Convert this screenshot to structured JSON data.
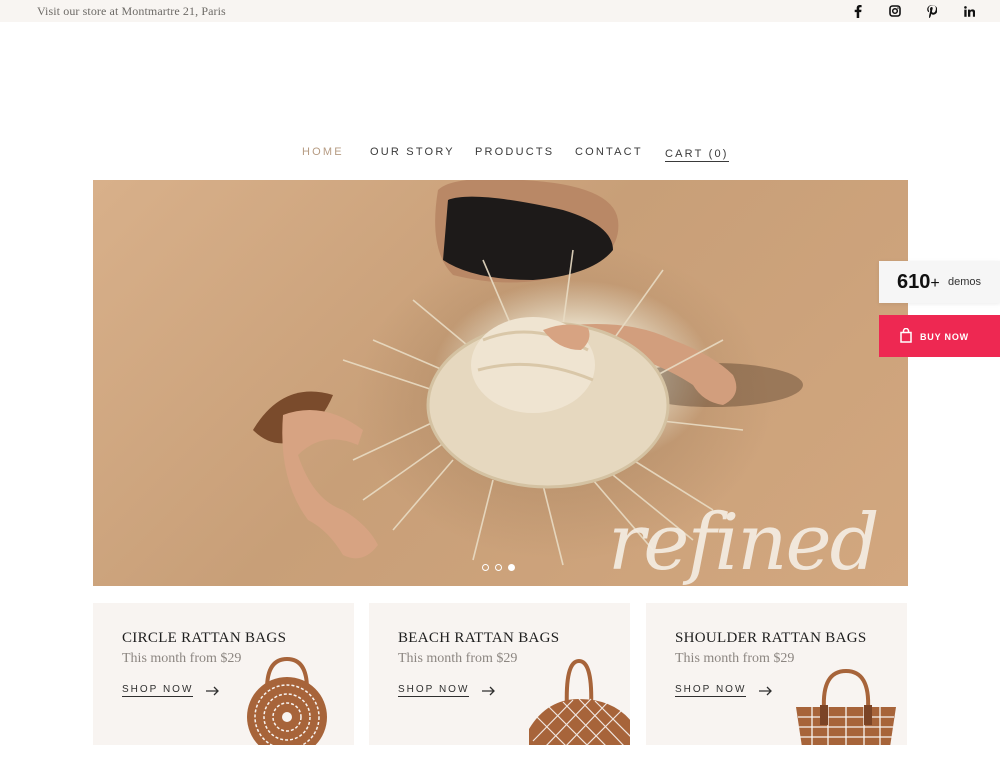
{
  "topbar": {
    "address": "Visit our store at Montmartre 21, Paris",
    "social": [
      "facebook-icon",
      "instagram-icon",
      "pinterest-icon",
      "linkedin-icon"
    ]
  },
  "nav": {
    "home": "HOME",
    "story": "OUR STORY",
    "products": "PRODUCTS",
    "contact": "CONTACT",
    "cart": "CART (0)"
  },
  "hero": {
    "script_text": "refined",
    "slides": 3,
    "active_slide": 3
  },
  "widget": {
    "demos_count": "610",
    "demos_plus": "+",
    "demos_label": "demos",
    "buy_label": "BUY NOW"
  },
  "cards": [
    {
      "title": "CIRCLE RATTAN BAGS",
      "subtitle": "This month from $29",
      "cta": "SHOP NOW",
      "icon": "circle-bag-icon"
    },
    {
      "title": "BEACH RATTAN BAGS",
      "subtitle": "This month from $29",
      "cta": "SHOP NOW",
      "icon": "beach-bag-icon"
    },
    {
      "title": "SHOULDER RATTAN BAGS",
      "subtitle": "This month from $29",
      "cta": "SHOP NOW",
      "icon": "shoulder-bag-icon"
    }
  ],
  "colors": {
    "accent_home": "#b69b82",
    "buy_button": "#ee2852",
    "bag_brown": "#a7643a",
    "card_bg": "#f8f4f1",
    "topbar_bg": "#f8f5f2"
  }
}
